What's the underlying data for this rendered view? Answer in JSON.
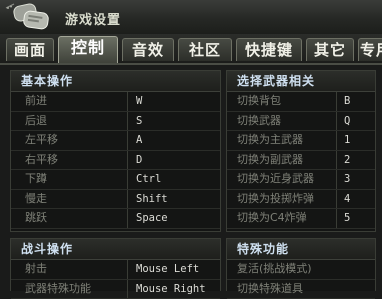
{
  "window": {
    "title": "游戏设置"
  },
  "tabs": [
    {
      "label": "画面",
      "active": false
    },
    {
      "label": "控制",
      "active": true
    },
    {
      "label": "音效",
      "active": false
    },
    {
      "label": "社区",
      "active": false
    },
    {
      "label": "快捷键",
      "active": false
    },
    {
      "label": "其它",
      "active": false
    },
    {
      "label": "专用",
      "active": false
    }
  ],
  "basic": {
    "title": "基本操作",
    "rows": [
      {
        "action": "前进",
        "key": "W"
      },
      {
        "action": "后退",
        "key": "S"
      },
      {
        "action": "左平移",
        "key": "A"
      },
      {
        "action": "右平移",
        "key": "D"
      },
      {
        "action": "下蹲",
        "key": "Ctrl"
      },
      {
        "action": "慢走",
        "key": "Shift"
      },
      {
        "action": "跳跃",
        "key": "Space"
      }
    ]
  },
  "weapons": {
    "title": "选择武器相关",
    "rows": [
      {
        "action": "切换背包",
        "key": "B"
      },
      {
        "action": "切换武器",
        "key": "Q"
      },
      {
        "action": "切换为主武器",
        "key": "1"
      },
      {
        "action": "切换为副武器",
        "key": "2"
      },
      {
        "action": "切换为近身武器",
        "key": "3"
      },
      {
        "action": "切换为投掷炸弹",
        "key": "4"
      },
      {
        "action": "切换为C4炸弹",
        "key": "5"
      }
    ]
  },
  "combat": {
    "title": "战斗操作",
    "rows": [
      {
        "action": "射击",
        "key": "Mouse Left"
      },
      {
        "action": "武器特殊功能",
        "key": "Mouse Right"
      }
    ]
  },
  "special": {
    "title": "特殊功能",
    "rows": [
      {
        "action": "复活(挑战模式)",
        "key": ""
      },
      {
        "action": "切换特殊道具",
        "key": ""
      }
    ]
  },
  "colors": {
    "heading": "#cfe0f0",
    "label": "#7f8178",
    "value": "#dcdcd6",
    "background": "#141514"
  },
  "icons": {
    "logo": "dog-tags-icon"
  }
}
